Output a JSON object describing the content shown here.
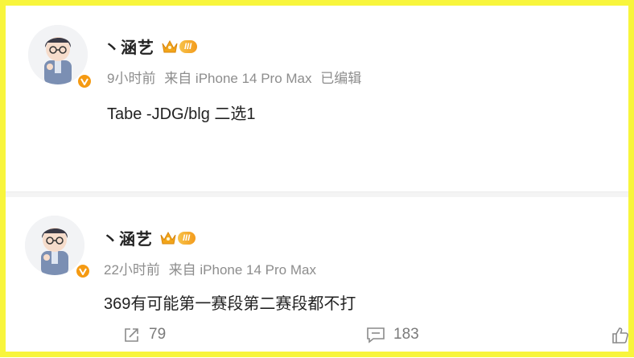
{
  "posts": [
    {
      "author": "丶涵艺",
      "level_badge": "III",
      "time": "9小时前",
      "source": "来自 iPhone 14 Pro Max",
      "edited": "已编辑",
      "content": "Tabe -JDG/blg 二选1"
    },
    {
      "author": "丶涵艺",
      "level_badge": "III",
      "time": "22小时前",
      "source": "来自 iPhone 14 Pro Max",
      "content": "369有可能第一赛段第二赛段都不打",
      "actions": {
        "share_count": "79",
        "comment_count": "183"
      }
    }
  ],
  "colors": {
    "frame": "#f8f53c",
    "verified_badge": "#f59a12",
    "meta_text": "#8d8d8d"
  },
  "icons": {
    "verified": "verified-v-icon",
    "crown": "crown-icon",
    "share": "share-icon",
    "comment": "comment-icon",
    "like": "thumbs-up-icon"
  }
}
